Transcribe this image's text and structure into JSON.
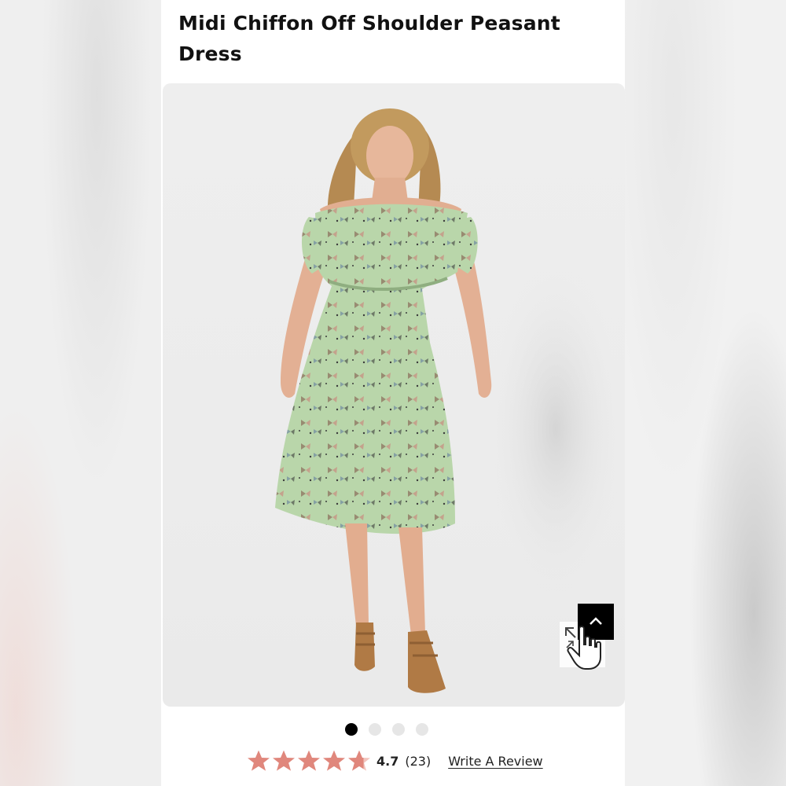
{
  "product": {
    "title": "Midi Chiffon Off Shoulder Peasant Dress",
    "image_alt": "Model wearing green butterfly print midi chiffon off shoulder peasant dress"
  },
  "carousel": {
    "total_slides": 4,
    "active_index": 0
  },
  "rating": {
    "value": "4.7",
    "count": "(23)",
    "stars_filled": 4.7,
    "stars_total": 5,
    "write_review_label": "Write A Review"
  },
  "colors": {
    "star": "#e0877c",
    "dress": "#b7d4a8",
    "background": "#ffffff",
    "text": "#111111"
  },
  "icons": {
    "scroll_top": "chevron-up-icon",
    "zoom": "expand-icon",
    "cursor": "hand-pointer-icon"
  }
}
